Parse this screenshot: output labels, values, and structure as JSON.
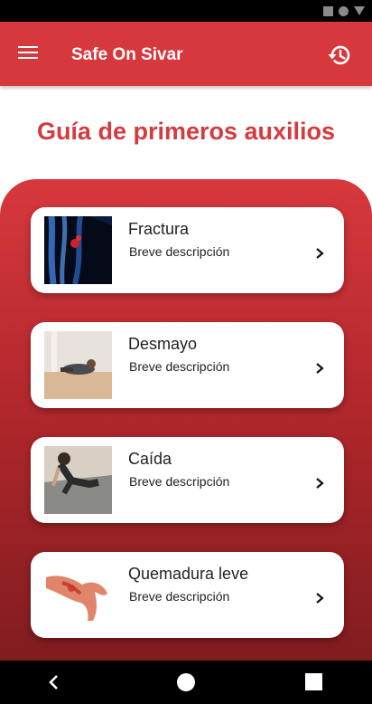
{
  "app": {
    "title": "Safe On Sivar",
    "colors": {
      "primary": "#d7383d",
      "panel_bottom": "#7f1c1e",
      "title_red": "#d43a3f"
    }
  },
  "appbar": {
    "menu_icon": "hamburger-menu-icon",
    "history_icon": "history-icon"
  },
  "page": {
    "title": "Guía de primeros auxilios"
  },
  "cards": [
    {
      "title": "Fractura",
      "description": "Breve descripción",
      "image": "xray-bones-image",
      "chevron": "chevron-right-icon"
    },
    {
      "title": "Desmayo",
      "description": "Breve descripción",
      "image": "person-fainted-image",
      "chevron": "chevron-right-icon"
    },
    {
      "title": "Caída",
      "description": "Breve descripción",
      "image": "person-fall-image",
      "chevron": "chevron-right-icon"
    },
    {
      "title": "Quemadura leve",
      "description": "Breve descripción",
      "image": "burned-hand-image",
      "chevron": "chevron-right-icon"
    }
  ],
  "navbar": {
    "back_icon": "back-triangle-icon",
    "home_icon": "home-circle-icon",
    "recents_icon": "recents-square-icon"
  }
}
